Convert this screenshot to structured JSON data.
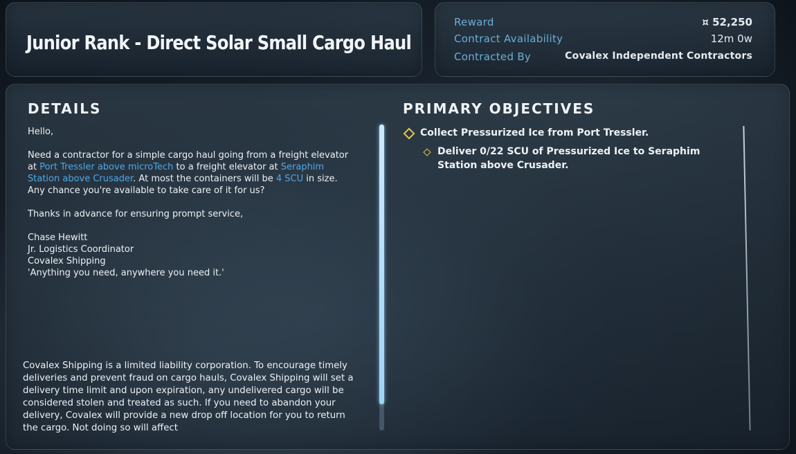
{
  "contract": {
    "title": "Junior Rank - Direct Solar Small Cargo Haul"
  },
  "info": {
    "reward_label": "Reward",
    "reward_value": "¤ 52,250",
    "availability_label": "Contract Availability",
    "availability_value": "12m 0w",
    "contracted_by_label": "Contracted By",
    "contracted_by_value": "Covalex Independent Contractors"
  },
  "details": {
    "heading": "DETAILS",
    "greeting": "Hello,",
    "body_1": "Need a contractor for a simple cargo haul going from a freight elevator at ",
    "pickup": "Port Tressler above microTech",
    "body_2": " to a freight elevator at ",
    "dropoff": "Seraphim Station above Crusader",
    "body_3": ". At most the containers will be ",
    "size": "4 SCU",
    "body_4": " in size. Any chance you're available to take care of it for us?",
    "thanks": "Thanks in advance for ensuring prompt service,",
    "sig_name": "Chase Hewitt",
    "sig_title": "Jr. Logistics Coordinator",
    "sig_company": "Covalex Shipping",
    "sig_motto": "'Anything you need, anywhere you need it.'",
    "legal": "Covalex Shipping is a limited liability corporation. To encourage timely deliveries and prevent fraud on cargo hauls, Covalex Shipping will set a delivery time limit and upon expiration, any undelivered cargo will be considered stolen and treated as such. If you need to abandon your delivery, Covalex will provide a new drop off location for you to return the cargo. Not doing so will affect"
  },
  "objectives": {
    "heading": "PRIMARY OBJECTIVES",
    "items": [
      {
        "text": "Collect Pressurized Ice from Port Tressler."
      },
      {
        "text": "Deliver 0/22 SCU of Pressurized Ice to Seraphim Station above Crusader."
      }
    ]
  },
  "colors": {
    "highlight": "#4fa8e6",
    "label": "#6aaed6",
    "objective_marker": "#e4c64a"
  }
}
